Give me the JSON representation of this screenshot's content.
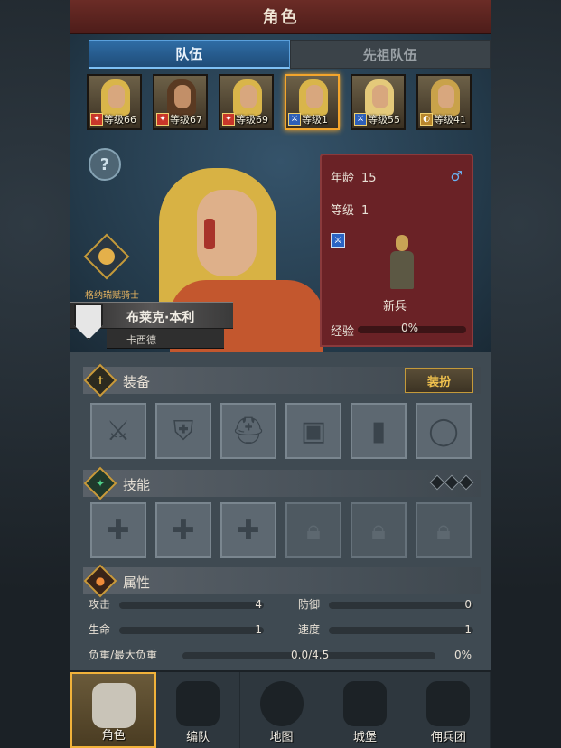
{
  "header": {
    "title": "角色"
  },
  "tabs": [
    {
      "label": "队伍",
      "active": true
    },
    {
      "label": "先祖队伍",
      "active": false
    }
  ],
  "roster": [
    {
      "level_text": "等级66",
      "class_icon": "fire-icon",
      "selected": false
    },
    {
      "level_text": "等级67",
      "class_icon": "fire-icon",
      "selected": false
    },
    {
      "level_text": "等级69",
      "class_icon": "fire-icon",
      "selected": false
    },
    {
      "level_text": "等级1",
      "class_icon": "sword-icon",
      "selected": true
    },
    {
      "level_text": "等级55",
      "class_icon": "sword-icon",
      "selected": false
    },
    {
      "level_text": "等级41",
      "class_icon": "shield-icon",
      "selected": false
    }
  ],
  "hero": {
    "title": "格纳瑞赋骑士",
    "name": "布莱克·本利",
    "origin": "卡西德"
  },
  "info": {
    "age_label": "年龄",
    "age_value": "15",
    "level_label": "等级",
    "level_value": "1",
    "class_name": "新兵",
    "exp_label": "经验",
    "exp_value": "0%",
    "gender_symbol": "♂"
  },
  "equipment": {
    "label": "装备",
    "dress_button": "装扮",
    "slots": [
      "sword-icon",
      "shield-icon",
      "helmet-icon",
      "armor-icon",
      "boots-icon",
      "ring-icon"
    ]
  },
  "skills": {
    "label": "技能",
    "slots": [
      "cross-icon",
      "cross-icon",
      "cross-icon",
      "lock-icon",
      "lock-icon",
      "lock-icon"
    ]
  },
  "attributes": {
    "label": "属性",
    "attack_label": "攻击",
    "attack_value": "4",
    "defense_label": "防御",
    "defense_value": "0",
    "hp_label": "生命",
    "hp_value": "1",
    "speed_label": "速度",
    "speed_value": "1",
    "load_label": "负重/最大负重",
    "load_value": "0.0/4.5",
    "load_pct": "0%"
  },
  "nav": [
    {
      "label": "角色",
      "active": true,
      "icon": "knight-icon"
    },
    {
      "label": "编队",
      "active": false,
      "icon": "formation-icon"
    },
    {
      "label": "地图",
      "active": false,
      "icon": "compass-icon"
    },
    {
      "label": "城堡",
      "active": false,
      "icon": "castle-icon"
    },
    {
      "label": "佣兵团",
      "active": false,
      "icon": "mercenary-icon"
    }
  ]
}
